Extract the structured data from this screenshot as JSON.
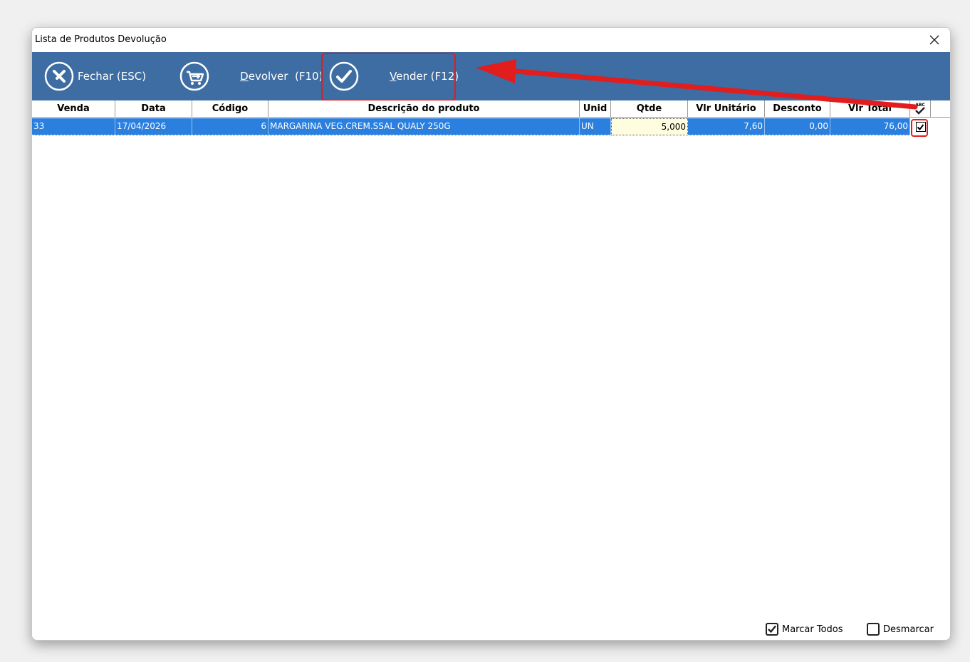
{
  "window": {
    "title": "Lista de Produtos Devolução"
  },
  "toolbar": {
    "fechar": {
      "label": "Fechar (ESC)",
      "icon": "close-circle-icon"
    },
    "devolver": {
      "hotkey_letter": "D",
      "label_rest": "evolver  (F10)",
      "icon": "return-cart-icon"
    },
    "vender": {
      "hotkey_letter": "V",
      "label_rest": "ender (F12)",
      "icon": "check-circle-icon"
    }
  },
  "grid": {
    "columns": [
      "Venda",
      "Data",
      "Código",
      "Descrição do produto",
      "Unid",
      "Qtde",
      "Vlr Unitário",
      "Desconto",
      "Vlr Total"
    ],
    "check_column_icon": "abc-check-icon",
    "check_column_icon_text": "ABC",
    "rows": [
      {
        "venda": "33",
        "data": "17/04/2026",
        "codigo": "6",
        "descricao": "MARGARINA VEG.CREM.SSAL QUALY 250G",
        "unid": "UN",
        "qtde": "5,000",
        "vlr_unitario": "7,60",
        "desconto": "0,00",
        "vlr_total": "76,00",
        "checked": true
      }
    ]
  },
  "footer": {
    "marcar_todos": "Marcar Todos",
    "desmarcar": "Desmarcar"
  },
  "colors": {
    "toolbar_bg": "#3d6da2",
    "row_selected_bg": "#2b7fde",
    "annotation_red": "#e11d1d"
  }
}
